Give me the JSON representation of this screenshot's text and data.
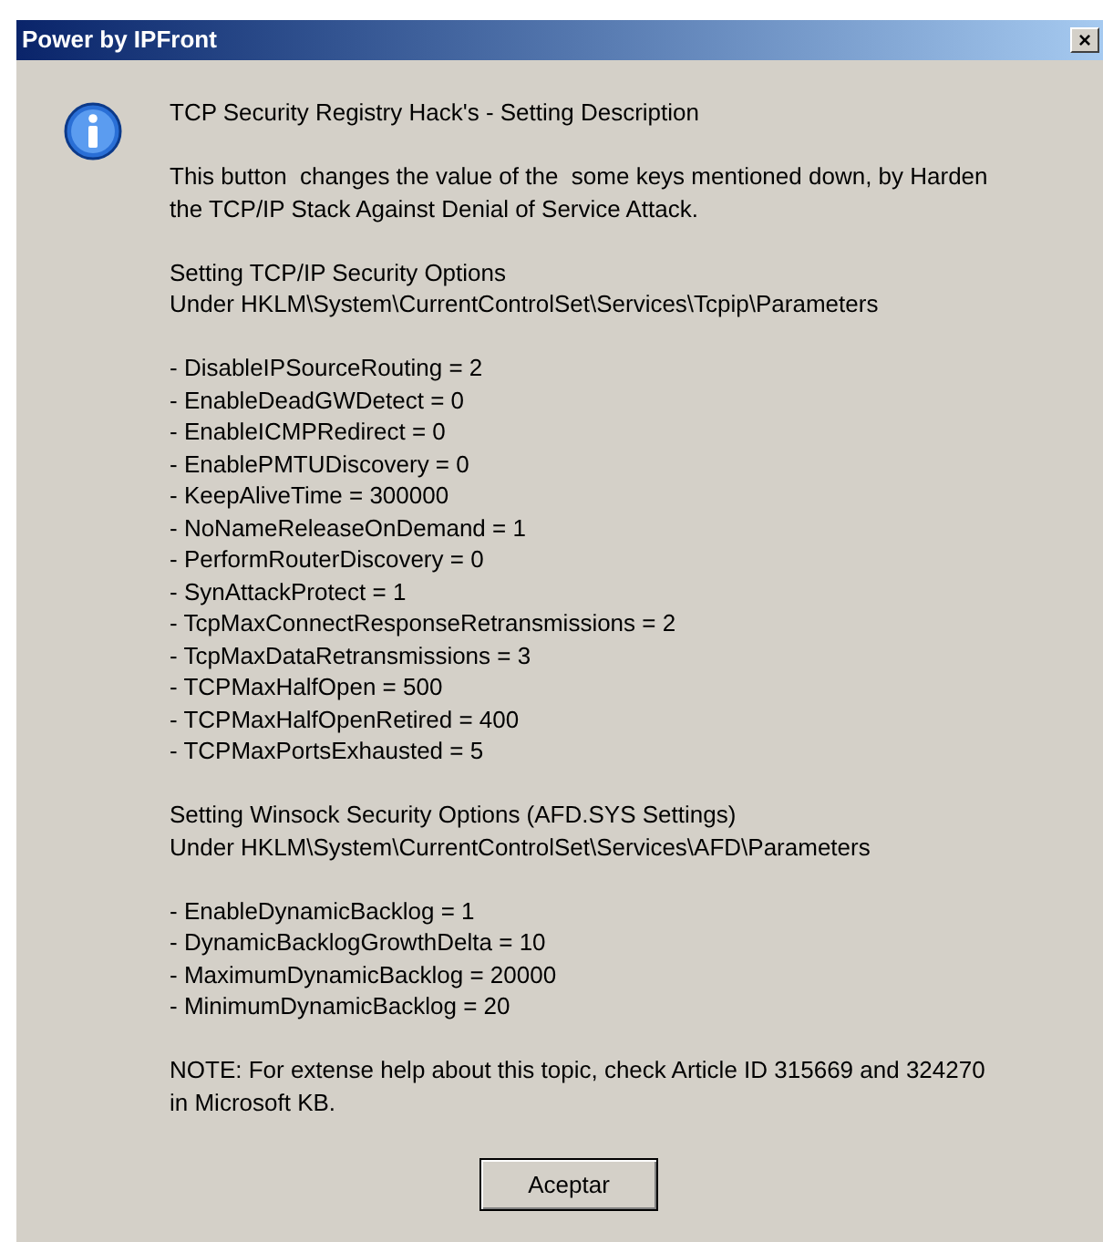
{
  "window": {
    "title": "Power by IPFront",
    "close": "×"
  },
  "message": {
    "paragraphs": [
      [
        "TCP Security Registry Hack's - Setting Description"
      ],
      [
        "This button  changes the value of the  some keys mentioned down, by Harden",
        "the TCP/IP Stack Against Denial of Service Attack."
      ],
      [
        "Setting TCP/IP Security Options",
        "Under HKLM\\System\\CurrentControlSet\\Services\\Tcpip\\Parameters"
      ],
      [
        "- DisableIPSourceRouting = 2",
        "- EnableDeadGWDetect = 0",
        "- EnableICMPRedirect = 0",
        "- EnablePMTUDiscovery = 0",
        "- KeepAliveTime = 300000",
        "- NoNameReleaseOnDemand = 1",
        "- PerformRouterDiscovery = 0",
        "- SynAttackProtect = 1",
        "- TcpMaxConnectResponseRetransmissions = 2",
        "- TcpMaxDataRetransmissions = 3",
        "- TCPMaxHalfOpen = 500",
        "- TCPMaxHalfOpenRetired = 400",
        "- TCPMaxPortsExhausted = 5"
      ],
      [
        "Setting Winsock Security Options (AFD.SYS Settings)",
        "Under HKLM\\System\\CurrentControlSet\\Services\\AFD\\Parameters"
      ],
      [
        "- EnableDynamicBacklog = 1",
        "- DynamicBacklogGrowthDelta = 10",
        "- MaximumDynamicBacklog = 20000",
        "- MinimumDynamicBacklog = 20"
      ],
      [
        "NOTE: For extense help about this topic, check Article ID 315669 and 324270",
        "in Microsoft KB."
      ]
    ]
  },
  "buttons": [
    "Aceptar"
  ]
}
